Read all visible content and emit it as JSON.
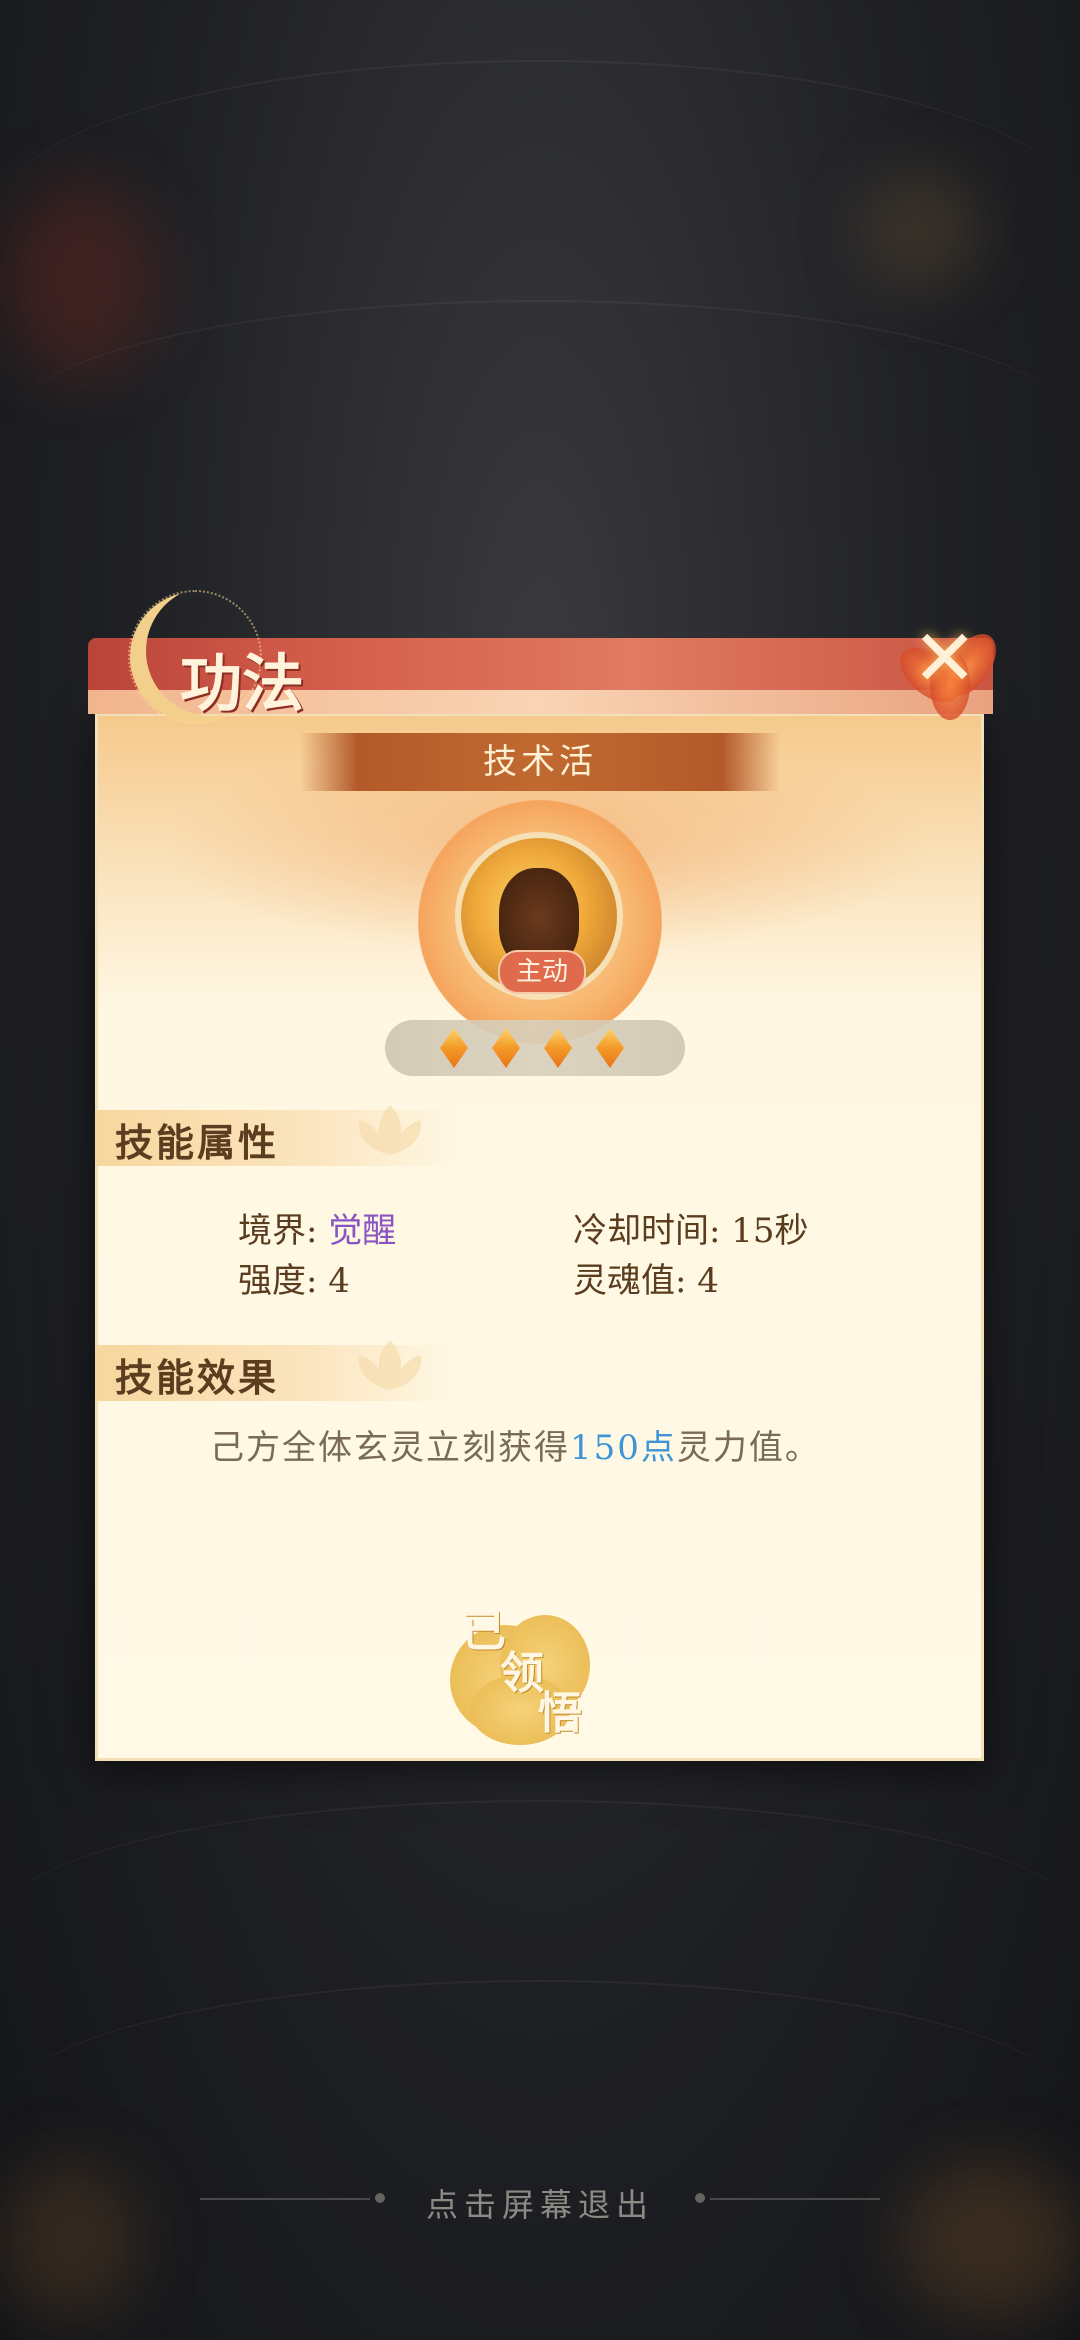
{
  "dialog": {
    "title": "功法",
    "close_icon": "close-icon"
  },
  "skill": {
    "name": "技术活",
    "type_tag": "主动",
    "level_diamonds": 4
  },
  "attributes": {
    "header": "技能属性",
    "realm_label": "境界: ",
    "realm_value": "觉醒",
    "cooldown": "冷却时间: 15秒",
    "strength": "强度: 4",
    "soul_value": "灵魂值: 4"
  },
  "effect": {
    "header": "技能效果",
    "text_before": "己方全体玄灵立刻获得",
    "highlight": "150点",
    "text_after": "灵力值。"
  },
  "stamp": {
    "char1": "已",
    "char2": "领",
    "char3": "悟"
  },
  "footer": {
    "exit_hint": "点击屏幕退出"
  },
  "colors": {
    "realm_value": "#8a54c2",
    "highlight": "#3d95d8",
    "ribbon": "#d35c4a"
  }
}
